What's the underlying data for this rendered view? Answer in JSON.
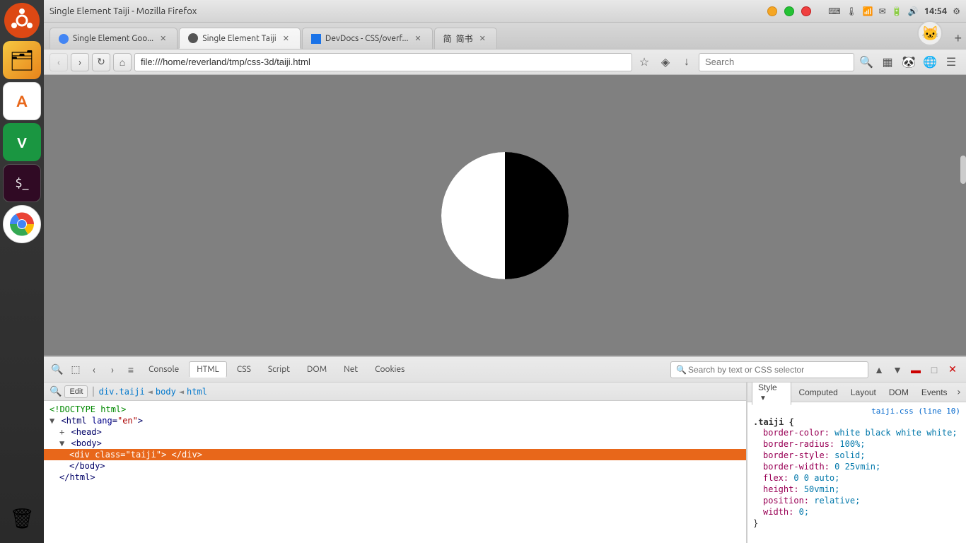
{
  "window": {
    "title": "Single Element Taiji - Mozilla Firefox"
  },
  "sidebar": {
    "icons": [
      {
        "name": "ubuntu-icon",
        "label": "Ubuntu"
      },
      {
        "name": "files-icon",
        "label": "Files"
      },
      {
        "name": "font-icon",
        "label": "Font"
      },
      {
        "name": "vim-icon",
        "label": "Vim"
      },
      {
        "name": "terminal-icon",
        "label": "Terminal"
      },
      {
        "name": "chrome-icon",
        "label": "Chrome"
      },
      {
        "name": "trash-icon",
        "label": "Trash"
      }
    ]
  },
  "tabs": [
    {
      "id": "tab1",
      "label": "Single Element Goo...",
      "favicon": "circle",
      "active": false
    },
    {
      "id": "tab2",
      "label": "Single Element Taiji",
      "favicon": "circle",
      "active": true
    },
    {
      "id": "tab3",
      "label": "DevDocs - CSS/overf...",
      "favicon": "square",
      "active": false
    },
    {
      "id": "tab4",
      "label": "简书",
      "favicon": "square",
      "active": false
    }
  ],
  "navbar": {
    "url": "file:///home/reverland/tmp/css-3d/taiji.html",
    "search_placeholder": "Search"
  },
  "devtools": {
    "toolbar_tabs": [
      "Console",
      "HTML",
      "CSS",
      "Script",
      "DOM",
      "Net",
      "Cookies"
    ],
    "active_toolbar_tab": "HTML",
    "search_placeholder": "Search by text or CSS selector",
    "breadcrumb": [
      "div.taiji",
      "body",
      "html"
    ],
    "style_tabs": [
      "Style",
      "Computed",
      "Layout",
      "DOM",
      "Events"
    ],
    "active_style_tab": "Style",
    "rule_file": "taiji.css (line 10)",
    "selector": ".taiji {",
    "properties": [
      {
        "prop": "border-color:",
        "value": "white black white white;"
      },
      {
        "prop": "border-radius:",
        "value": "100%;"
      },
      {
        "prop": "border-style:",
        "value": "solid;"
      },
      {
        "prop": "border-width:",
        "value": "0 25vmin;"
      },
      {
        "prop": "flex:",
        "value": "0 0 auto;"
      },
      {
        "prop": "height:",
        "value": "50vmin;"
      },
      {
        "prop": "position:",
        "value": "relative;"
      },
      {
        "prop": "width:",
        "value": "0;"
      }
    ],
    "html_lines": [
      {
        "indent": 0,
        "content": "<!DOCTYPE html>",
        "type": "comment"
      },
      {
        "indent": 0,
        "content": "<html lang=\"en\">",
        "type": "tag",
        "toggle": "▼"
      },
      {
        "indent": 1,
        "content": "+ <head>",
        "type": "tag",
        "toggle": "+"
      },
      {
        "indent": 1,
        "content": "▼ <body>",
        "type": "tag",
        "toggle": "▼"
      },
      {
        "indent": 2,
        "content": "<div class=\"taiji\"> </div>",
        "type": "tag",
        "selected": true
      },
      {
        "indent": 2,
        "content": "</body>",
        "type": "tag"
      },
      {
        "indent": 1,
        "content": "</html>",
        "type": "tag"
      }
    ]
  },
  "computed_tab": "Computed"
}
